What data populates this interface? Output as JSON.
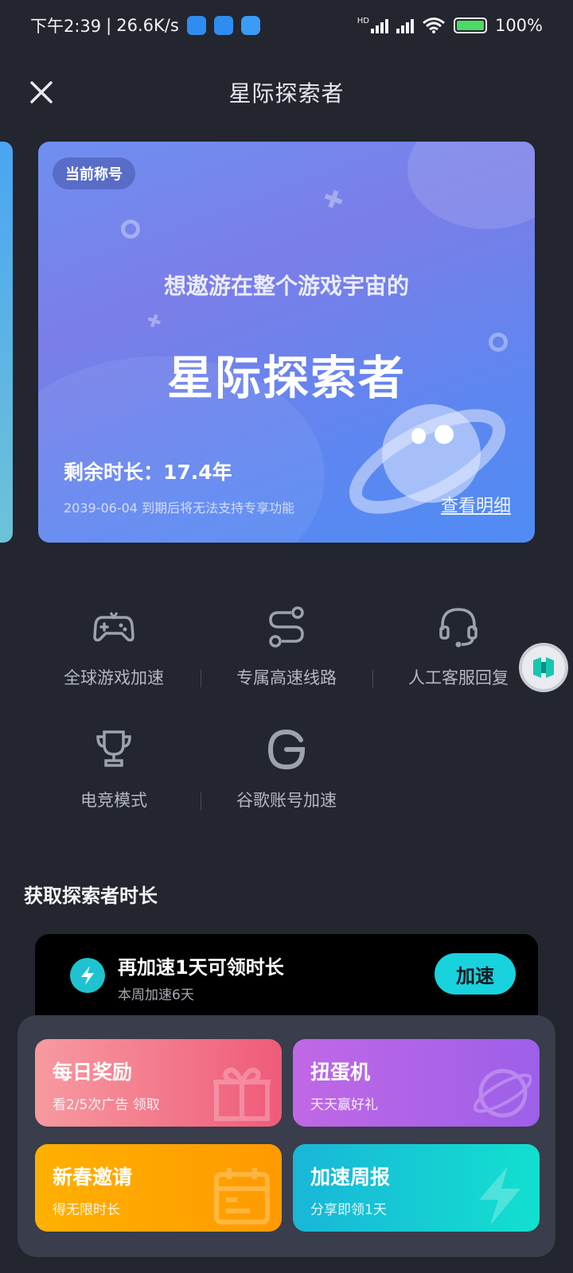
{
  "status_bar": {
    "time": "下午2:39",
    "net_speed": "26.6K/s",
    "hd_label": "HD",
    "battery_percent": "100%"
  },
  "header": {
    "title": "星际探索者"
  },
  "title_card": {
    "badge": "当前称号",
    "subtitle": "想遨游在整个游戏宇宙的",
    "title": "星际探索者",
    "remaining": "剩余时长：17.4年",
    "expire_note": "2039-06-04 到期后将无法支持专享功能",
    "detail_link": "查看明细"
  },
  "features": [
    {
      "label": "全球游戏加速",
      "icon": "gamepad-icon"
    },
    {
      "label": "专属高速线路",
      "icon": "route-icon"
    },
    {
      "label": "人工客服回复",
      "icon": "headset-icon"
    },
    {
      "label": "电竞模式",
      "icon": "trophy-icon"
    },
    {
      "label": "谷歌账号加速",
      "icon": "google-icon"
    }
  ],
  "section": {
    "title": "获取探索者时长"
  },
  "task": {
    "title": "再加速1天可领时长",
    "subtitle": "本周加速6天",
    "button": "加速"
  },
  "tiles": [
    {
      "title": "每日奖励",
      "subtitle": "看2/5次广告 领取",
      "icon": "gift-icon",
      "color": "#ef5b7a"
    },
    {
      "title": "扭蛋机",
      "subtitle": "天天赢好礼",
      "icon": "planet-icon",
      "color": "#9d5fe9"
    },
    {
      "title": "新春邀请",
      "subtitle": "得无限时长",
      "icon": "calendar-icon",
      "color": "#ff9a00"
    },
    {
      "title": "加速周报",
      "subtitle": "分享即领1天",
      "icon": "lightning-icon",
      "color": "#12e0cf"
    }
  ],
  "colors": {
    "background": "#23252f",
    "accent": "#18d2dd"
  }
}
